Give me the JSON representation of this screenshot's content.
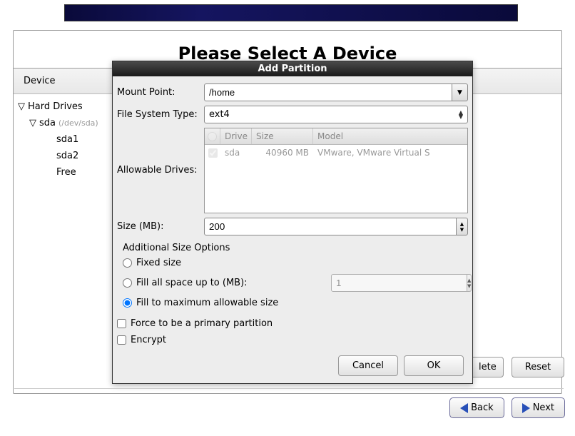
{
  "page": {
    "title": "Please Select A Device"
  },
  "device_panel": {
    "header": "Device"
  },
  "tree": {
    "root": "Hard Drives",
    "disk": "sda",
    "disk_path": "(/dev/sda)",
    "items": [
      "sda1",
      "sda2",
      "Free"
    ]
  },
  "dialog": {
    "title": "Add Partition",
    "labels": {
      "mount_point": "Mount Point:",
      "fs_type": "File System Type:",
      "allowable_drives": "Allowable Drives:",
      "size": "Size (MB):",
      "additional": "Additional Size Options",
      "fixed": "Fixed size",
      "fill_upto": "Fill all space up to (MB):",
      "fill_max": "Fill to maximum allowable size",
      "force_primary": "Force to be a primary partition",
      "encrypt": "Encrypt"
    },
    "values": {
      "mount_point": "/home",
      "fs_type": "ext4",
      "size": "200",
      "fill_upto_value": "1"
    },
    "drives_header": {
      "drive": "Drive",
      "size": "Size",
      "model": "Model"
    },
    "drives_row": {
      "drive": "sda",
      "size": "40960 MB",
      "model": "VMware, VMware Virtual S"
    },
    "buttons": {
      "cancel": "Cancel",
      "ok": "OK"
    }
  },
  "bg_buttons": {
    "delete": "lete",
    "reset": "Reset"
  },
  "nav": {
    "back": "Back",
    "next": "Next"
  }
}
